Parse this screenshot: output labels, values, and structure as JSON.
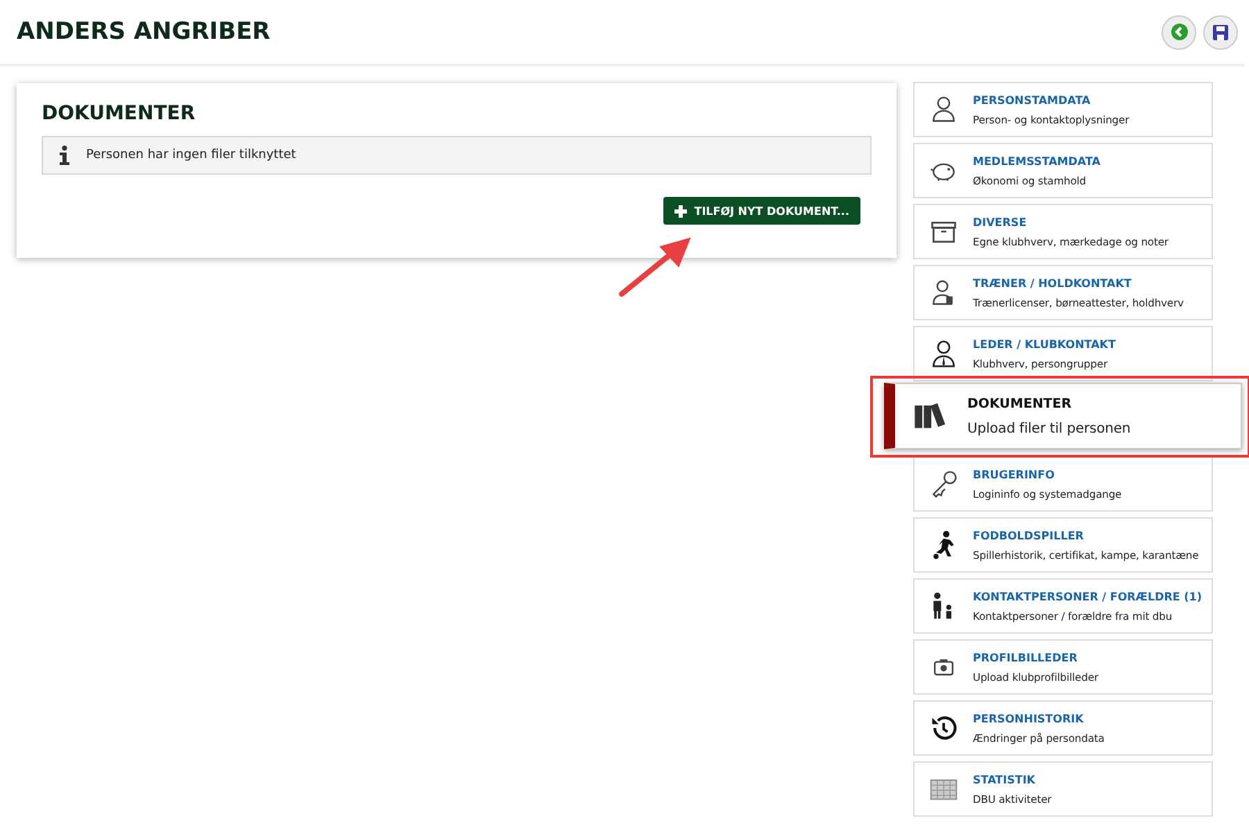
{
  "page_title": "ANDERS ANGRIBER",
  "section": {
    "heading": "DOKUMENTER",
    "info": "Personen har ingen filer tilknyttet",
    "add_button": "TILFØJ NYT DOKUMENT..."
  },
  "nav": [
    {
      "title": "PERSONSTAMDATA",
      "subtitle": "Person- og kontaktoplysninger",
      "selected": false
    },
    {
      "title": "MEDLEMSSTAMDATA",
      "subtitle": "Økonomi og stamhold",
      "selected": false
    },
    {
      "title": "DIVERSE",
      "subtitle": "Egne klubhverv, mærkedage og noter",
      "selected": false
    },
    {
      "title": "TRÆNER / HOLDKONTAKT",
      "subtitle": "Trænerlicenser, børneattester, holdhverv",
      "selected": false
    },
    {
      "title": "LEDER / KLUBKONTAKT",
      "subtitle": "Klubhverv, persongrupper",
      "selected": false
    },
    {
      "title": "DOKUMENTER",
      "subtitle": "Upload filer til personen",
      "selected": true
    },
    {
      "title": "BRUGERINFO",
      "subtitle": "Logininfo og systemadgange",
      "selected": false
    },
    {
      "title": "FODBOLDSPILLER",
      "subtitle": "Spillerhistorik, certifikat, kampe, karantæne",
      "selected": false
    },
    {
      "title": "KONTAKTPERSONER / FORÆLDRE (1)",
      "subtitle": "Kontaktpersoner / forældre fra mit dbu",
      "selected": false
    },
    {
      "title": "PROFILBILLEDER",
      "subtitle": "Upload klubprofilbilleder",
      "selected": false
    },
    {
      "title": "PERSONHISTORIK",
      "subtitle": "Ændringer på persondata",
      "selected": false
    },
    {
      "title": "STATISTIK",
      "subtitle": "DBU aktiviteter",
      "selected": false
    }
  ]
}
